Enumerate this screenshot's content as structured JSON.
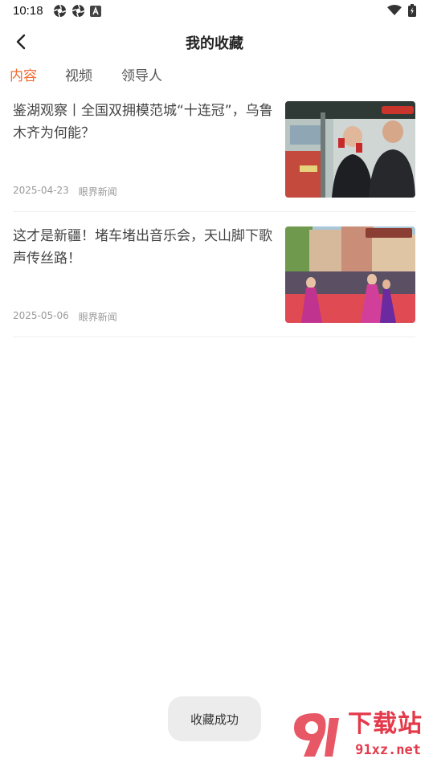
{
  "status_bar": {
    "time": "10:18"
  },
  "header": {
    "title": "我的收藏"
  },
  "tabs": [
    {
      "label": "内容",
      "active": true
    },
    {
      "label": "视频",
      "active": false
    },
    {
      "label": "领导人",
      "active": false
    }
  ],
  "items": [
    {
      "title": "鉴湖观察丨全国双拥模范城“十连冠”，乌鲁木齐为何能？",
      "date": "2025-04-23",
      "source": "眼界新闻"
    },
    {
      "title": "这才是新疆！堵车堵出音乐会，天山脚下歌声传丝路！",
      "date": "2025-05-06",
      "source": "眼界新闻"
    }
  ],
  "toast": {
    "text": "收藏成功"
  },
  "watermark": {
    "text": "下载站",
    "url": "91xz.net"
  },
  "colors": {
    "accent": "#f26b33",
    "watermark": "#e4394a"
  }
}
